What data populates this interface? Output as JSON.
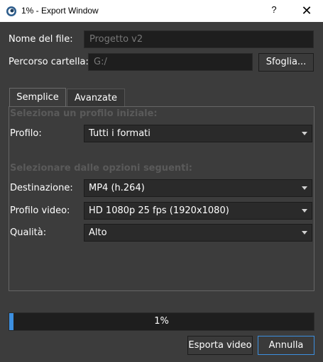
{
  "window": {
    "title": "1% - Export Window",
    "help_label": "?",
    "close_label": "✕"
  },
  "file": {
    "name_label": "Nome del file:",
    "name_placeholder": "Progetto v2",
    "folder_label": "Percorso cartella:",
    "folder_value": "G:/",
    "browse_label": "Sfoglia..."
  },
  "tabs": [
    {
      "label": "Semplice",
      "active": true
    },
    {
      "label": "Avanzate",
      "active": false
    }
  ],
  "simple": {
    "profile_section": "Seleziona un profilo iniziale:",
    "profile_label": "Profilo:",
    "profile_value": "Tutti i formati",
    "options_section": "Selezionare dalle opzioni seguenti:",
    "destination_label": "Destinazione:",
    "destination_value": "MP4 (h.264)",
    "video_profile_label": "Profilo video:",
    "video_profile_value": "HD 1080p 25 fps (1920x1080)",
    "quality_label": "Qualità:",
    "quality_value": "Alto"
  },
  "progress": {
    "percent": 1,
    "text": "1%"
  },
  "actions": {
    "export_label": "Esporta video",
    "cancel_label": "Annulla"
  },
  "colors": {
    "accent": "#3c8fe0",
    "background": "#3c3c3c",
    "field": "#1e1e1e"
  }
}
